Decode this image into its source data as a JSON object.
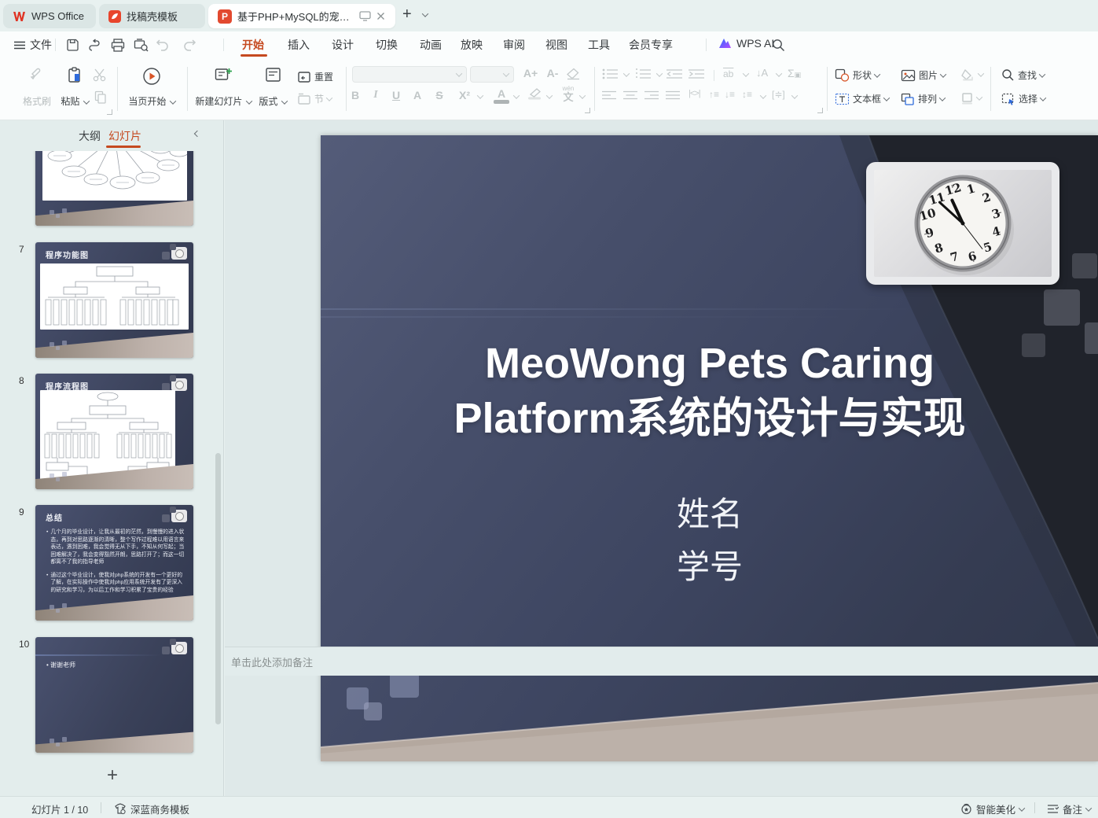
{
  "tabbar": {
    "home_tab": "WPS Office",
    "template_tab": "找稿壳模板",
    "doc_tab": "基于PHP+MySQL的宠物Meo",
    "doc_badge": "P",
    "new_tab": "+"
  },
  "menubar": {
    "file": "文件",
    "items": [
      "开始",
      "插入",
      "设计",
      "切换",
      "动画",
      "放映",
      "审阅",
      "视图",
      "工具",
      "会员专享"
    ],
    "wps_ai": "WPS AI"
  },
  "toolbar": {
    "format_painter": "格式刷",
    "paste": "粘贴",
    "play_from_page": "当页开始",
    "new_slide": "新建幻灯片",
    "layout": "版式",
    "reset": "重置",
    "section": "节",
    "increase_font": "A+",
    "decrease_font": "A-",
    "bold": "B",
    "italic": "I",
    "underline": "U",
    "char_border": "A",
    "strike": "S",
    "superscript": "X²",
    "font_color": "A",
    "phonetic": "文",
    "phonetic_pinyin": "wén",
    "shapes": "形状",
    "picture": "图片",
    "textbox": "文本框",
    "arrange": "排列",
    "find": "查找",
    "select": "选择"
  },
  "sidebar": {
    "tab_outline": "大纲",
    "tab_slides": "幻灯片",
    "add_slide": "+",
    "thumbs": [
      {
        "number": "",
        "title": ""
      },
      {
        "number": "7",
        "title": "程序功能图"
      },
      {
        "number": "8",
        "title": "程序流程图"
      },
      {
        "number": "9",
        "title": "总结",
        "bullets": [
          "几个月的毕业设计，让我从最初的茫然，到慢慢的进入状态，再到对思路逐渐的清晰，整个写作过程难以用语言来表达，遇到困难，我会觉得无从下手，不知从何写起；当困难解决了，我会变得豁然开朗，思路打开了；而这一切都离不了我的指导老师",
          "通过这个毕业设计，使我对php系统的开发有一个更好的了解，在实际操作中使我对php应用系统开发有了更深入的研究和学习，为以后工作和学习积累了宝贵的经验"
        ]
      },
      {
        "number": "10",
        "bullet": "谢谢老师"
      }
    ]
  },
  "slide": {
    "title_line1": "MeoWong Pets Caring",
    "title_line2": "Platform系统的设计与实现",
    "name_placeholder": "姓名",
    "id_placeholder": "学号"
  },
  "notes": {
    "placeholder": "单击此处添加备注"
  },
  "statusbar": {
    "slide_counter": "幻灯片 1 / 10",
    "template_name": "深蓝商务模板",
    "beautify": "智能美化",
    "notes": "备注"
  },
  "colors": {
    "accent_orange": "#c5491f",
    "slide_navy": "#3d4560",
    "ppt_red": "#e2492f"
  }
}
